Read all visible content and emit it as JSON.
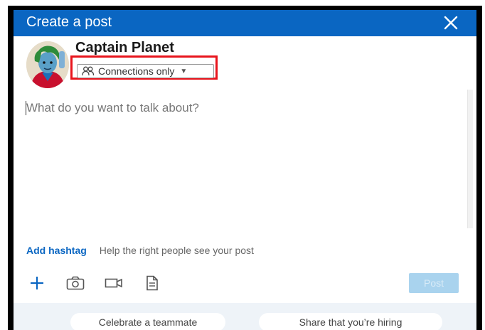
{
  "dialog": {
    "title": "Create a post"
  },
  "author": {
    "name": "Captain Planet",
    "visibility": "Connections only"
  },
  "composer": {
    "placeholder": "What do you want to talk about?"
  },
  "hashtag": {
    "add_label": "Add hashtag",
    "help_text": "Help the right people see your post"
  },
  "toolbar": {
    "icons": [
      "plus-icon",
      "camera-icon",
      "video-icon",
      "document-icon"
    ],
    "post_label": "Post"
  },
  "suggestions": [
    "Celebrate a teammate",
    "Share that you’re hiring"
  ],
  "colors": {
    "header": "#0a66c2",
    "highlight": "#e8141c",
    "post_disabled": "#a9d3ee"
  }
}
